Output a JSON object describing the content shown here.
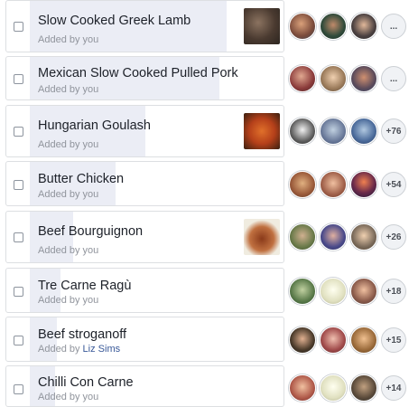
{
  "options": [
    {
      "title": "Slow Cooked Greek Lamb",
      "sub": "Added by you",
      "by": "",
      "votes": "...",
      "thumb": "lamb",
      "fill": 0.75
    },
    {
      "title": "Mexican Slow Cooked Pulled Pork",
      "sub": "Added by you",
      "by": "",
      "votes": "...",
      "thumb": "",
      "fill": 0.73
    },
    {
      "title": "Hungarian Goulash",
      "sub": "Added by you",
      "by": "",
      "votes": "+76",
      "thumb": "goulash",
      "fill": 0.45
    },
    {
      "title": "Butter Chicken",
      "sub": "Added by you",
      "by": "",
      "votes": "+54",
      "thumb": "",
      "fill": 0.34
    },
    {
      "title": "Beef Bourguignon",
      "sub": "Added by you",
      "by": "",
      "votes": "+26",
      "thumb": "bourguignon",
      "fill": 0.17
    },
    {
      "title": "Tre Carne Ragù",
      "sub": "Added by you",
      "by": "",
      "votes": "+18",
      "thumb": "",
      "fill": 0.11
    },
    {
      "title": "Beef stroganoff",
      "sub": "Added by",
      "by": "Liz Sims",
      "votes": "+15",
      "thumb": "",
      "fill": 0.1
    },
    {
      "title": "Chilli Con Carne",
      "sub": "Added by you",
      "by": "",
      "votes": "+14",
      "thumb": "",
      "fill": 0.09
    }
  ]
}
